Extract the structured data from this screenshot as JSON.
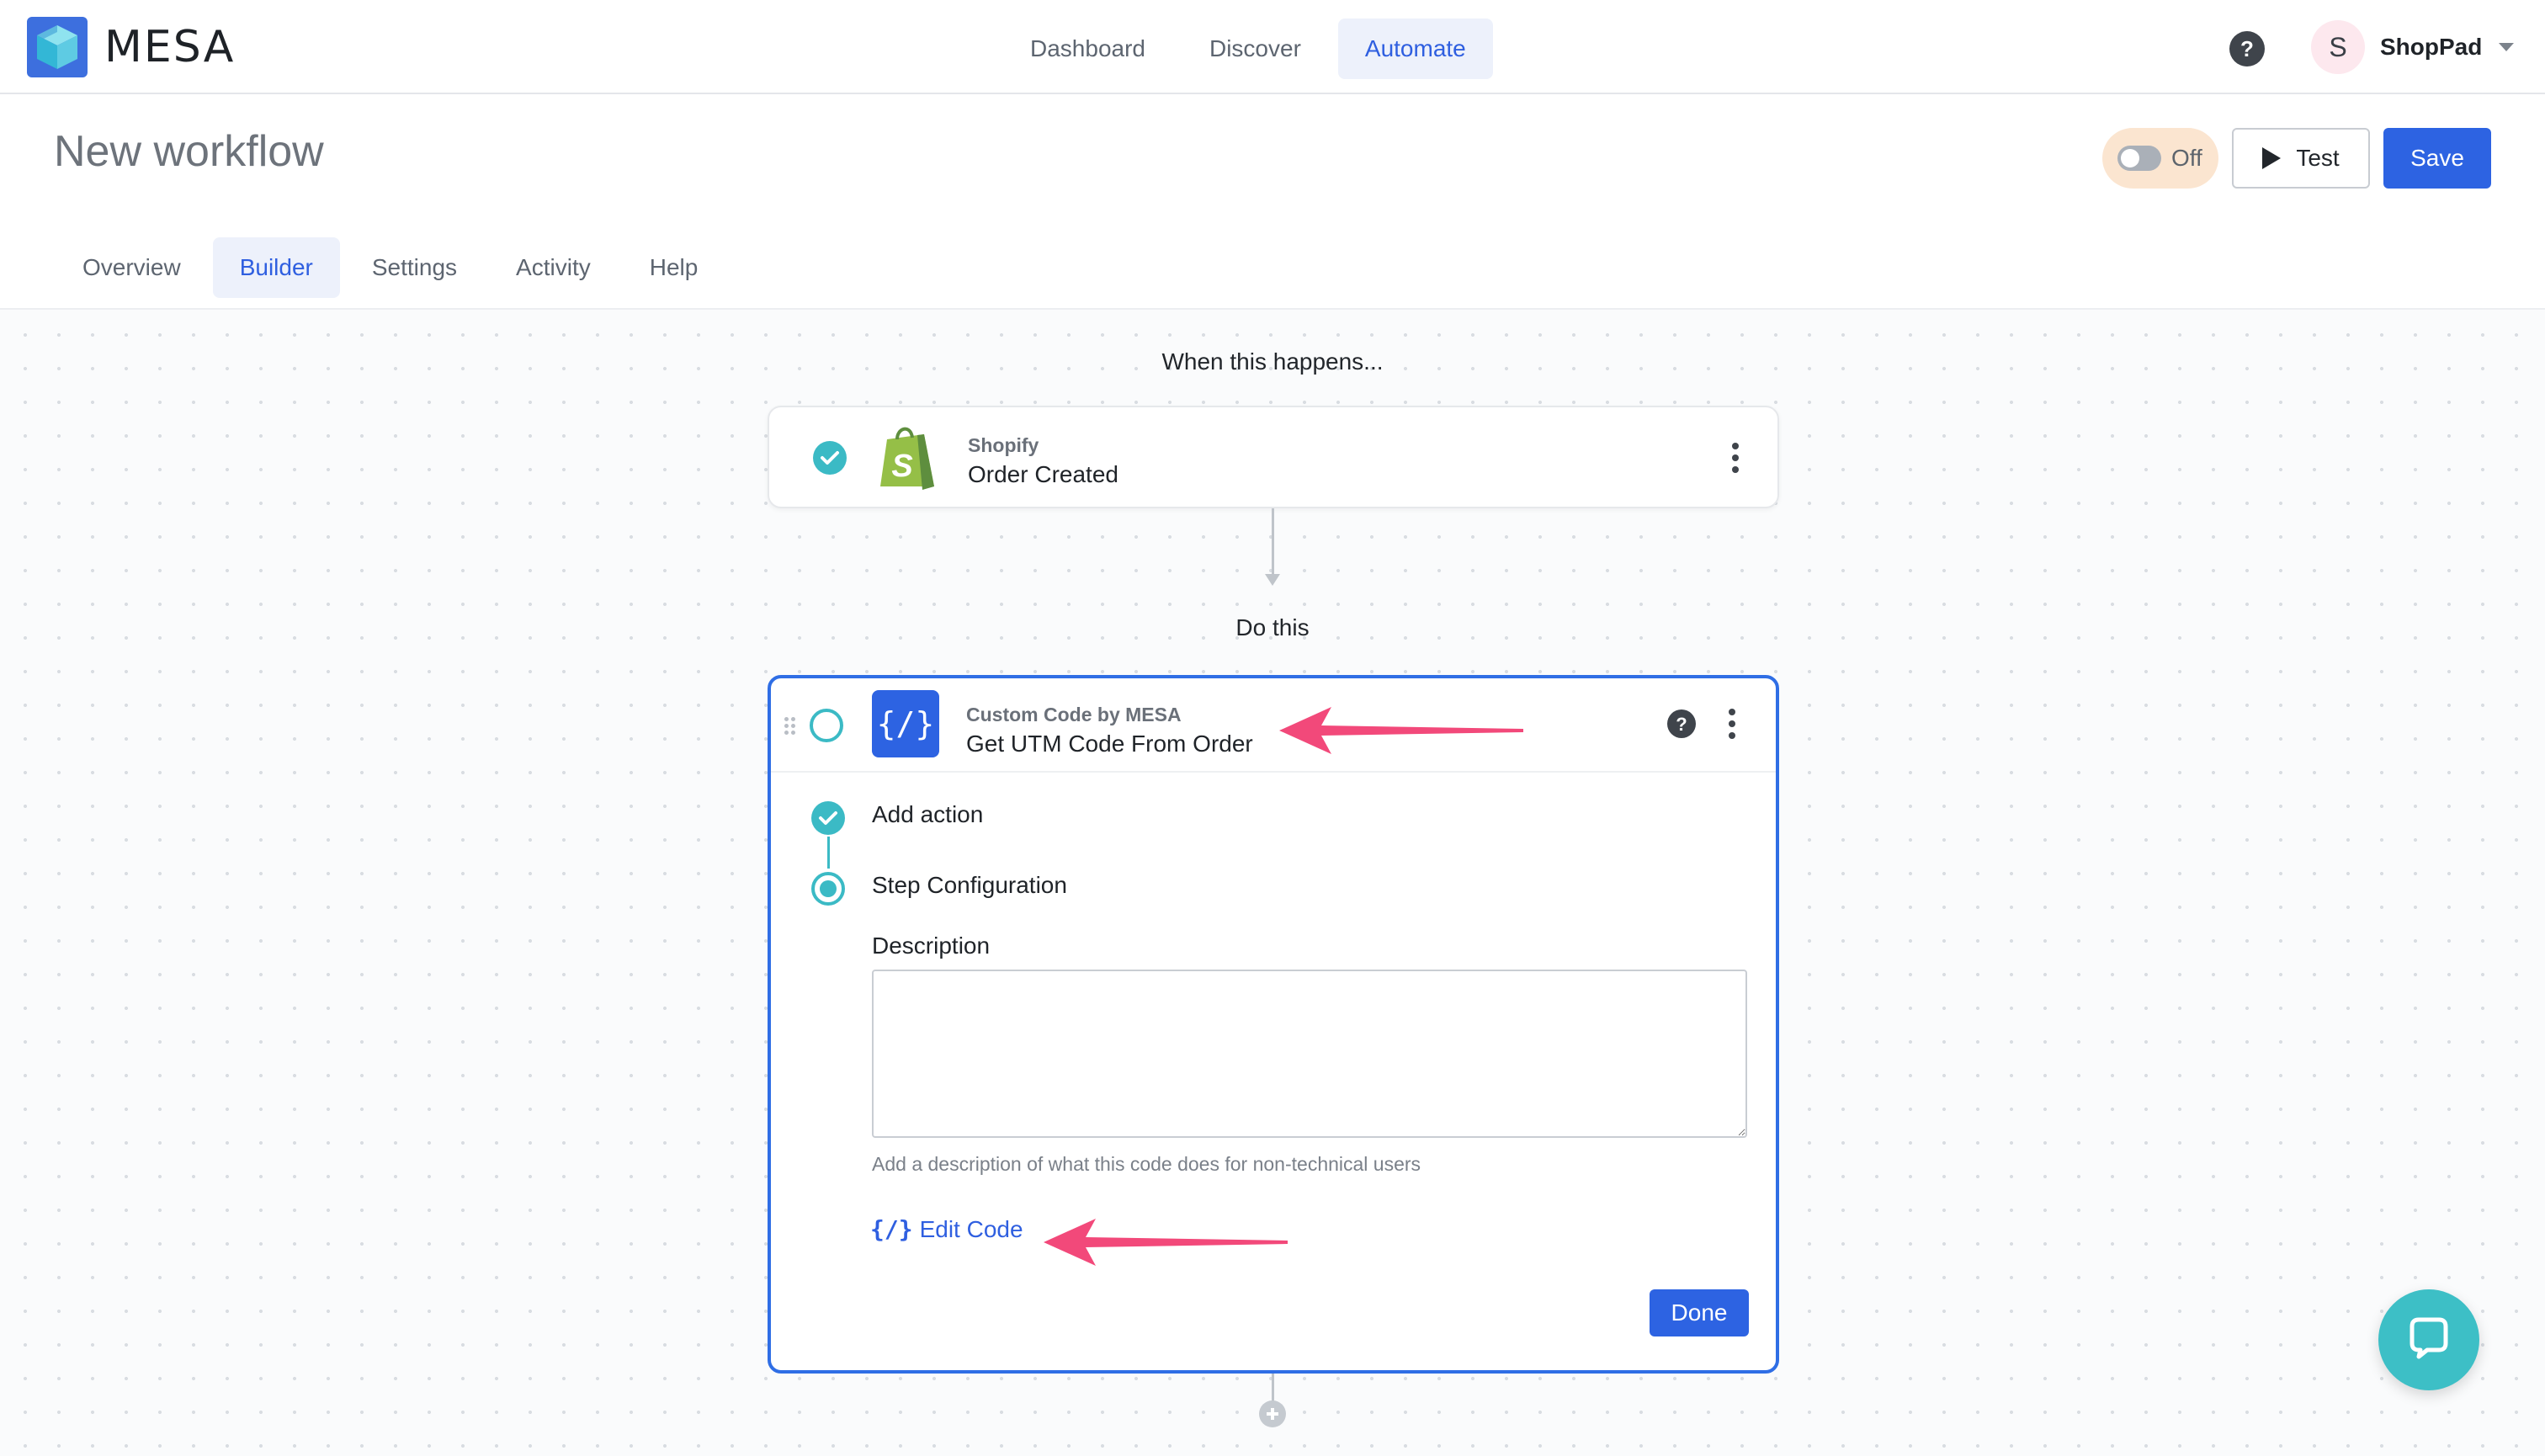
{
  "app": {
    "logo_text": "MESA",
    "nav": [
      "Dashboard",
      "Discover",
      "Automate"
    ],
    "nav_active": "Automate",
    "account": {
      "initial": "S",
      "name": "ShopPad"
    }
  },
  "header": {
    "title": "New workflow",
    "toggle_label": "Off",
    "test_label": "Test",
    "save_label": "Save"
  },
  "tabs": [
    "Overview",
    "Builder",
    "Settings",
    "Activity",
    "Help"
  ],
  "tabs_active": "Builder",
  "workflow": {
    "trigger_label": "When this happens...",
    "trigger": {
      "app": "Shopify",
      "event": "Order Created"
    },
    "action_label": "Do this",
    "action": {
      "app": "Custom Code by MESA",
      "name": "Get UTM Code From Order",
      "icon_text": "{/}",
      "steps": [
        "Add action",
        "Step Configuration"
      ],
      "description_label": "Description",
      "description_value": "",
      "description_hint": "Add a description of what this code does for non-technical users",
      "edit_code_icon": "{/}",
      "edit_code_label": "Edit Code",
      "done_label": "Done"
    }
  },
  "colors": {
    "primary": "#2d63e2",
    "teal": "#3bbac5",
    "annotation": "#f2497a",
    "shopify_green": "#95bf47"
  },
  "icons": [
    "logo-cube-icon",
    "help-icon",
    "chevron-down-icon",
    "play-icon",
    "check-icon",
    "shopify-bag-icon",
    "kebab-menu-icon",
    "drag-handle-icon",
    "code-icon",
    "plus-icon",
    "chat-icon"
  ]
}
